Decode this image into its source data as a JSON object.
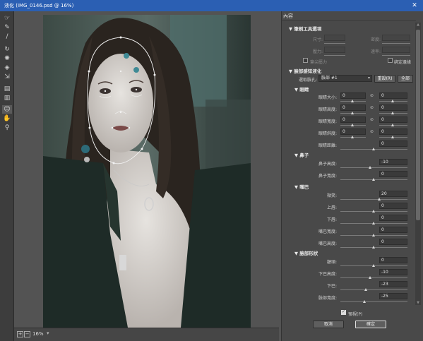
{
  "window": {
    "title": "液化 (IMG_0146.psd @ 16%)",
    "close_glyph": "✕"
  },
  "tools": [
    "brush",
    "reconstruct",
    "smooth",
    "twirl",
    "pucker",
    "bloat",
    "push",
    "freeze",
    "thaw",
    "face",
    "hand",
    "zoom"
  ],
  "status": {
    "zoom": "16%",
    "plus": "+",
    "minus": "−",
    "caret": "▾"
  },
  "panel": {
    "title": "內容",
    "brush_section": "▼ 筆刷工具選項",
    "brush": {
      "size_label": "尺寸:",
      "density_label": "密度:",
      "pressure_label": "壓力:",
      "rate_label": "速率:",
      "stylus_label": "筆尖壓力",
      "pin_edges_label": "綁定邊緣"
    },
    "face_section": "▼ 臉部感知液化",
    "face_select_label": "選取臉孔:",
    "face_select_value": "臉部 #1",
    "reset_button": "重設(R)",
    "all_button": "全部",
    "eyes_section": "▼ 眼睛",
    "eyes": [
      {
        "label": "眼睛大小:",
        "left": "0",
        "right": "0"
      },
      {
        "label": "眼睛高度:",
        "left": "0",
        "right": "0"
      },
      {
        "label": "眼睛寬度:",
        "left": "0",
        "right": "0"
      },
      {
        "label": "眼睛斜度:",
        "left": "0",
        "right": "0"
      },
      {
        "label": "眼睛距離:",
        "value": "0"
      }
    ],
    "nose_section": "▼ 鼻子",
    "nose": [
      {
        "label": "鼻子高度:",
        "value": "-10"
      },
      {
        "label": "鼻子寬度:",
        "value": "0"
      }
    ],
    "mouth_section": "▼ 嘴巴",
    "mouth": [
      {
        "label": "微笑:",
        "value": "20"
      },
      {
        "label": "上唇:",
        "value": "0"
      },
      {
        "label": "下唇:",
        "value": "0"
      },
      {
        "label": "嘴巴寬度:",
        "value": "0"
      },
      {
        "label": "嘴巴高度:",
        "value": "0"
      }
    ],
    "shape_section": "▼ 臉部形狀",
    "shape": [
      {
        "label": "額頭:",
        "value": "0"
      },
      {
        "label": "下巴高度:",
        "value": "-10"
      },
      {
        "label": "下巴:",
        "value": "-23"
      },
      {
        "label": "臉部寬度:",
        "value": "-25"
      }
    ],
    "preview_label": "預視(P)",
    "cancel_button": "取消",
    "ok_button": "確定",
    "link_glyph": "🔗"
  }
}
